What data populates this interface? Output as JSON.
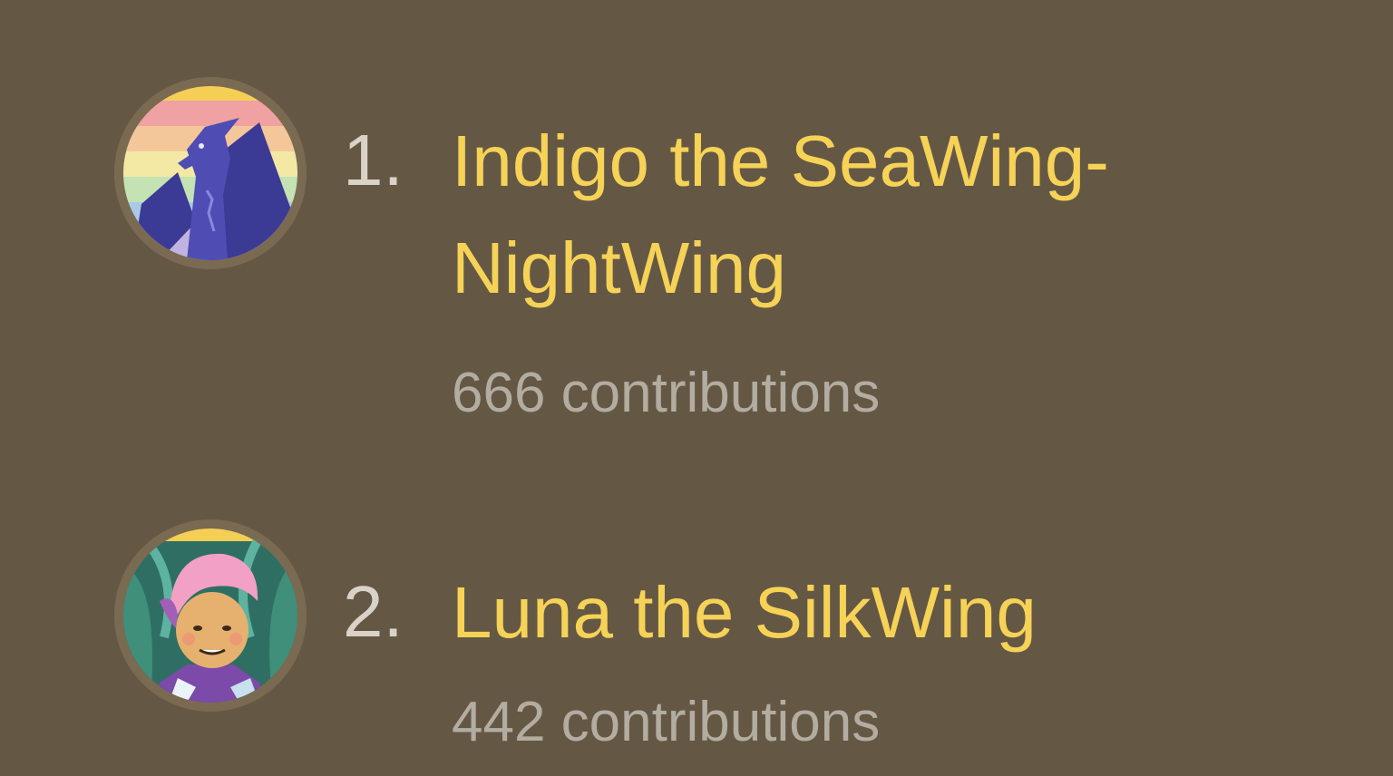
{
  "leaderboard": {
    "entries": [
      {
        "rank": "1.",
        "name": "Indigo the SeaWing-NightWing",
        "contributions": "666 contributions",
        "avatar_icon": "dragon-avatar-icon"
      },
      {
        "rank": "2.",
        "name": "Luna the SilkWing",
        "contributions": "442 contributions",
        "avatar_icon": "silkwing-avatar-icon"
      }
    ]
  },
  "colors": {
    "background": "#645845",
    "name": "#f6d257",
    "rank": "#d9d3c7",
    "contributions": "#b3aca1",
    "avatar_ring": "#7a6a52"
  }
}
